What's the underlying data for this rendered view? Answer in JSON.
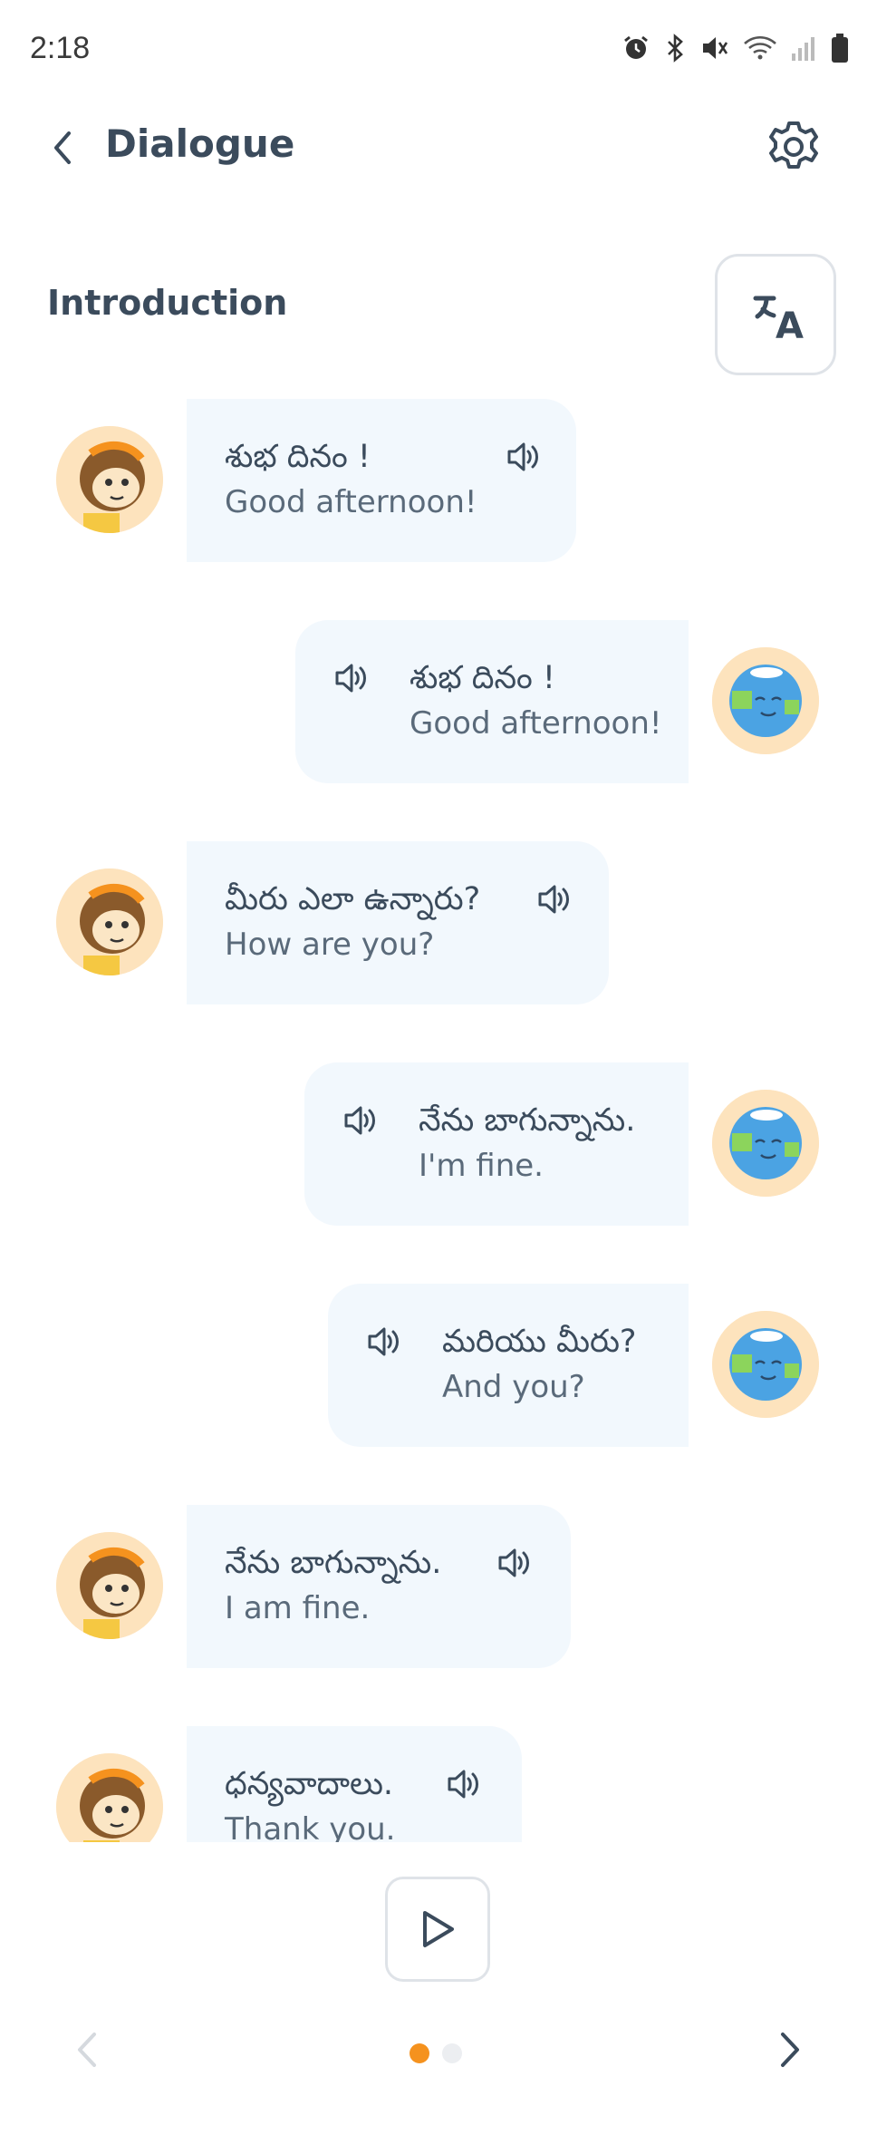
{
  "status_bar": {
    "time": "2:18",
    "icons": [
      "alarm-icon",
      "bluetooth-icon",
      "mute-icon",
      "wifi-icon",
      "signal-icon",
      "battery-icon"
    ]
  },
  "header": {
    "title": "Dialogue",
    "back_icon": "chevron-left-icon",
    "settings_icon": "gear-icon"
  },
  "section": {
    "title": "Introduction",
    "translate_icon": "translate-icon"
  },
  "colors": {
    "accent": "#f5921e",
    "bubble": "#f2f8fd",
    "text_dark": "#3b4b5c",
    "text_muted": "#5a6a7a"
  },
  "messages": [
    {
      "speaker": "monkey",
      "side": "left",
      "native": "శుభ దినం !",
      "translation": "Good afternoon!"
    },
    {
      "speaker": "earth",
      "side": "right",
      "native": "శుభ దినం !",
      "translation": "Good afternoon!"
    },
    {
      "speaker": "monkey",
      "side": "left",
      "native": "మీరు ఎలా ఉన్నారు?",
      "translation": "How are you?"
    },
    {
      "speaker": "earth",
      "side": "right",
      "native": "నేను బాగున్నాను.",
      "translation": "I'm fine."
    },
    {
      "speaker": "earth",
      "side": "right",
      "native": "మరియు మీరు?",
      "translation": "And you?"
    },
    {
      "speaker": "monkey",
      "side": "left",
      "native": "నేను బాగున్నాను.",
      "translation": "I am fine."
    },
    {
      "speaker": "monkey",
      "side": "left",
      "native": "ధన్యవాదాలు.",
      "translation": "Thank you."
    }
  ],
  "footer": {
    "play_icon": "play-icon",
    "prev_icon": "chevron-left-icon",
    "next_icon": "chevron-right-icon",
    "page_current": 1,
    "page_total": 2
  }
}
